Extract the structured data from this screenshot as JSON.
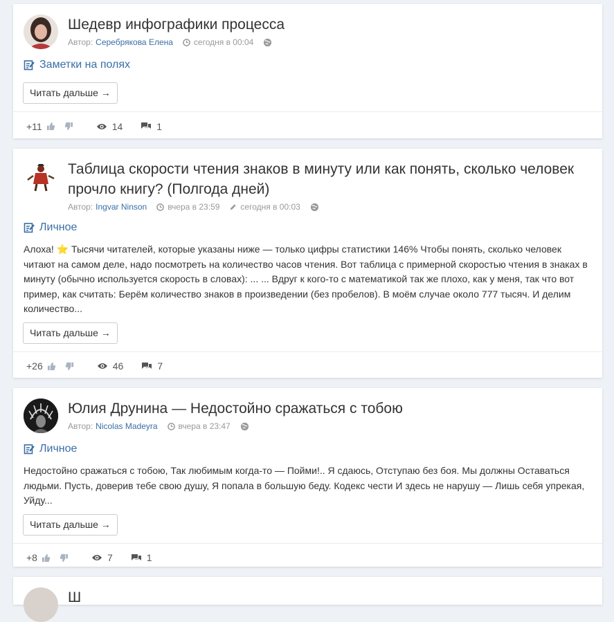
{
  "posts": [
    {
      "title": "Шедевр инфографики процесса",
      "author_label": "Автор:",
      "author": "Серебрякова Елена",
      "time": "сегодня в 00:04",
      "edited": "",
      "category": "Заметки на полях",
      "excerpt": "",
      "read_more": "Читать дальше →",
      "rating": "+11",
      "views": "14",
      "comments": "1"
    },
    {
      "title": "Таблица скорости чтения знаков в минуту или как понять, сколько человек прочло книгу? (Полгода дней)",
      "author_label": "Автор:",
      "author": "Ingvar Ninson",
      "time": "вчера в 23:59",
      "edited": "сегодня в 00:03",
      "category": "Личное",
      "excerpt_before_star": "Алоха!",
      "excerpt_star": "⭐",
      "excerpt": "Тысячи читателей, которые указаны ниже — только цифры статистики 146% Чтобы понять, сколько человек читают на самом деле, надо посмотреть на количество часов чтения. Вот таблица с примерной скоростью чтения в знаках в минуту (обычно используется скорость в словах): ... ... Вдруг к кого-то с математикой так же плохо, как у меня, так что вот пример, как считать: Берём количество знаков в произведении (без пробелов). В моём случае около 777 тысяч. И делим количество...",
      "read_more": "Читать дальше →",
      "rating": "+26",
      "views": "46",
      "comments": "7"
    },
    {
      "title": "Юлия Друнина — Недостойно сражаться с тобою",
      "author_label": "Автор:",
      "author": "Nicolas Madeyra",
      "time": "вчера в 23:47",
      "edited": "",
      "category": "Личное",
      "excerpt": "Недостойно сражаться с тобою, Так любимым когда-то — Пойми!.. Я сдаюсь, Отступаю без боя. Мы должны Оставаться людьми. Пусть, доверив тебе свою душу, Я попала в большую беду. Кодекс чести И здесь не нарушу — Лишь себя упрекая, Уйду...",
      "read_more": "Читать дальше →",
      "rating": "+8",
      "views": "7",
      "comments": "1"
    },
    {
      "title": "Ш"
    }
  ],
  "icons": {
    "clock": "clock-icon",
    "pencil": "pencil-icon",
    "globe": "globe-icon",
    "category": "edit-note-icon",
    "like": "thumbs-up-icon",
    "dislike": "thumbs-down-icon",
    "views": "eye-icon",
    "comments": "comments-icon"
  },
  "colors": {
    "link": "#3a6ea5",
    "meta": "#999999",
    "background": "#eef1f5",
    "star": "#f5b400"
  }
}
